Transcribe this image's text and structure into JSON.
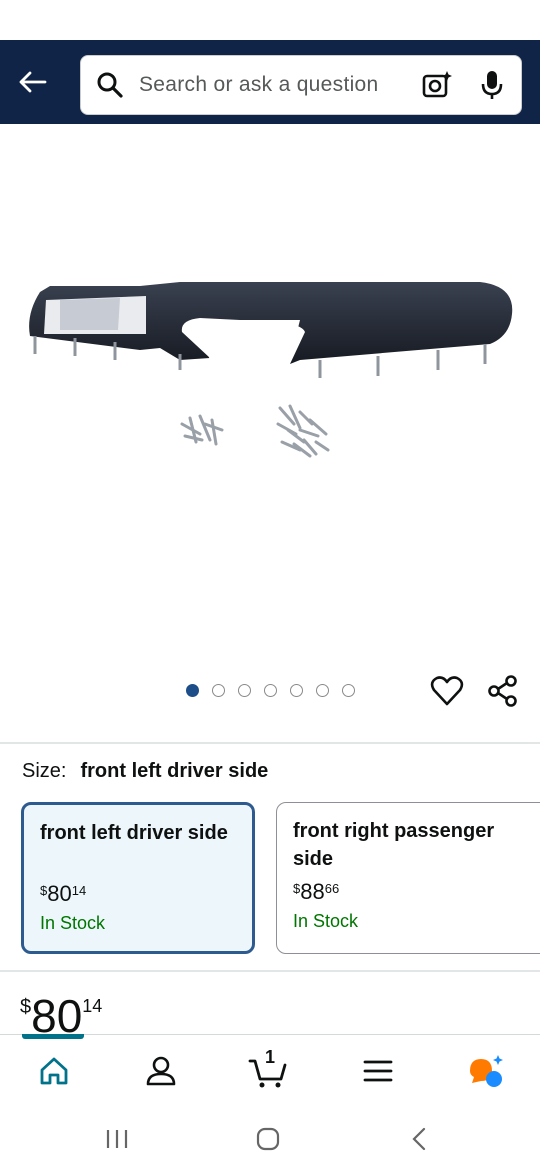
{
  "search": {
    "placeholder": "Search or ask a question"
  },
  "gallery": {
    "image_count": 7,
    "active_index": 0
  },
  "size": {
    "label": "Size:",
    "selected_value": "front left driver side",
    "options": [
      {
        "name": "front left driver side",
        "currency": "$",
        "whole": "80",
        "fraction": "14",
        "stock": "In Stock"
      },
      {
        "name": "front right passenger side",
        "currency": "$",
        "whole": "88",
        "fraction": "66",
        "stock": "In Stock"
      }
    ]
  },
  "price": {
    "currency": "$",
    "whole": "80",
    "fraction": "14"
  },
  "cart": {
    "count": "1"
  },
  "colors": {
    "header_bg": "#0f2447",
    "accent": "#00728a",
    "in_stock": "#007600",
    "selected_border": "#2e5b8f",
    "selected_bg": "#edf7fb",
    "active_dot": "#1d4e89"
  }
}
